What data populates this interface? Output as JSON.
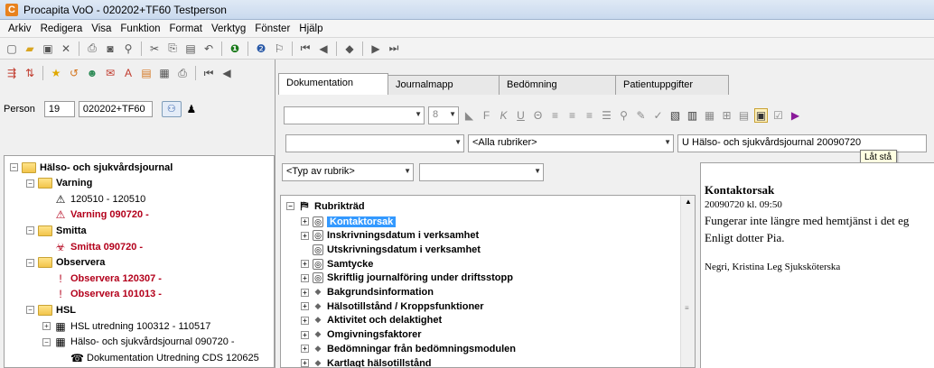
{
  "window": {
    "title": "Procapita VoO - 020202+TF60 Testperson",
    "logo": "C"
  },
  "menu": [
    "Arkiv",
    "Redigera",
    "Visa",
    "Funktion",
    "Format",
    "Verktyg",
    "Fönster",
    "Hjälp"
  ],
  "toolbar": {
    "icons": [
      "new-icon",
      "open-icon",
      "save-icon",
      "delete-icon",
      "print-icon",
      "preview-icon",
      "find-icon",
      "cut-icon",
      "copy-icon",
      "paste-icon",
      "undo-icon",
      "info-icon",
      "help-icon",
      "context-help-icon",
      "first-icon",
      "prev-icon",
      "add-icon",
      "next-icon",
      "last-icon"
    ]
  },
  "person": {
    "label": "Person",
    "number": "19",
    "id": "020202+TF60"
  },
  "left_tree": [
    {
      "label": "Hälso- och sjukvårdsjournal",
      "style": "bold",
      "level": 0,
      "folder": true,
      "exp": "−"
    },
    {
      "label": "Varning",
      "style": "bold",
      "level": 1,
      "folder": true,
      "exp": "−"
    },
    {
      "label": "120510 - 120510",
      "style": "normal",
      "level": 2,
      "icon": "⚠"
    },
    {
      "label": "Varning 090720 -",
      "style": "red",
      "level": 2,
      "icon": "⚠"
    },
    {
      "label": "Smitta",
      "style": "bold",
      "level": 1,
      "folder": true,
      "exp": "−"
    },
    {
      "label": "Smitta 090720 -",
      "style": "red",
      "level": 2,
      "icon": "☣"
    },
    {
      "label": "Observera",
      "style": "bold",
      "level": 1,
      "folder": true,
      "exp": "−"
    },
    {
      "label": "Observera 120307 -",
      "style": "red",
      "level": 2,
      "icon": "!"
    },
    {
      "label": "Observera 101013 -",
      "style": "red",
      "level": 2,
      "icon": "!"
    },
    {
      "label": "HSL",
      "style": "bold",
      "level": 1,
      "folder": true,
      "exp": "−"
    },
    {
      "label": "HSL utredning 100312 - 110517",
      "style": "normal",
      "level": 2,
      "icon": "▦",
      "exp": "+"
    },
    {
      "label": "Hälso- och sjukvårdsjournal 090720 -",
      "style": "normal",
      "level": 2,
      "icon": "▦",
      "exp": "−"
    },
    {
      "label": "Dokumentation Utredning CDS 120625",
      "style": "normal",
      "level": 3,
      "icon": "☎"
    }
  ],
  "tabs": [
    "Dokumentation",
    "Journalmapp",
    "Bedömning",
    "Patientuppgifter"
  ],
  "format": {
    "font_size": "8",
    "bold": "F",
    "italic": "K",
    "underline": "U"
  },
  "filters": {
    "rubriker": "<Alla rubriker>",
    "journal": "U Hälso- och sjukvårdsjournal 20090720",
    "typ": "<Typ av rubrik>"
  },
  "tooltip": "Låt stå",
  "rubrik_tree": {
    "root": "Rubrikträd",
    "items": [
      "Kontaktorsak",
      "Inskrivningsdatum i verksamhet",
      "Utskrivningsdatum i verksamhet",
      "Samtycke",
      "Skriftlig journalföring under driftsstopp",
      "Bakgrundsinformation",
      "Hälsotillstånd / Kroppsfunktioner",
      "Aktivitet och delaktighet",
      "Omgivningsfaktorer",
      "Bedömningar från bedömningsmodulen",
      "Kartlagt hälsotillstånd"
    ]
  },
  "note": {
    "title": "Kontaktorsak",
    "date": "20090720 kl. 09:50",
    "line1": "Fungerar inte längre med hemtjänst i det eg",
    "line2": "Enligt dotter Pia.",
    "signature": "Negri, Kristina Leg Sjuksköterska"
  }
}
